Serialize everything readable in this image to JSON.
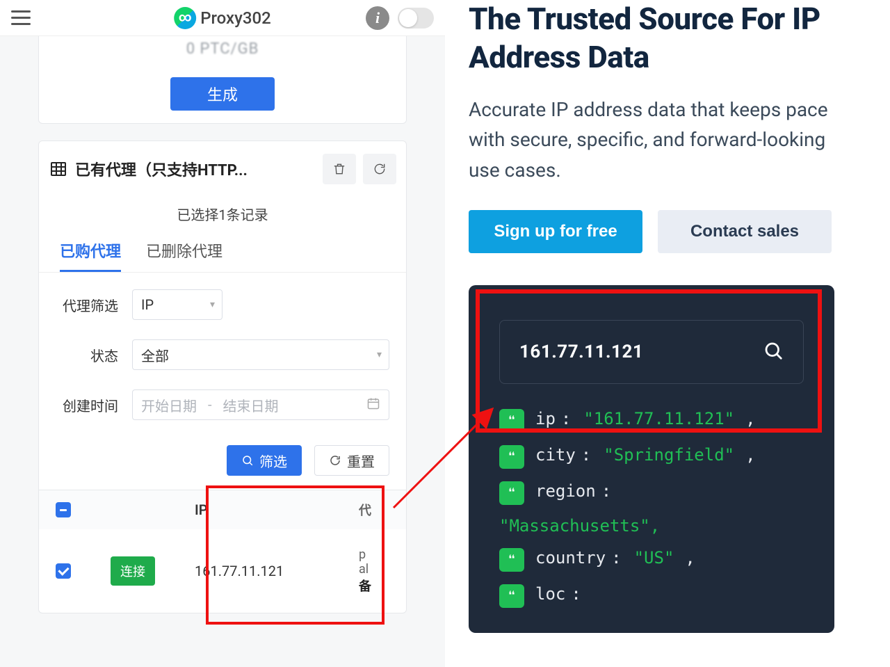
{
  "left": {
    "brand": "Proxy302",
    "price_text": "0 PTC/GB",
    "generate_btn": "生成",
    "card2_title": "已有代理（只支持HTTP...",
    "selected_note": "已选择1条记录",
    "tabs": {
      "purchased": "已购代理",
      "deleted": "已删除代理"
    },
    "filters": {
      "proxy_filter_label": "代理筛选",
      "proxy_filter_value": "IP",
      "status_label": "状态",
      "status_value": "全部",
      "created_label": "创建时间",
      "start_placeholder": "开始日期",
      "end_placeholder": "结束日期"
    },
    "actions": {
      "filter": "筛选",
      "reset": "重置"
    },
    "table": {
      "col_ip": "IP",
      "col_rest_head": "代",
      "row": {
        "connect": "连接",
        "ip": "161.77.11.121",
        "rest1": "p",
        "rest2": "al",
        "rest3": "备"
      }
    }
  },
  "right": {
    "title": "The Trusted Source For IP Address Data",
    "subtitle": "Accurate IP address data that keeps pace with secure, specific, and forward-looking use cases.",
    "cta_signup": "Sign up for free",
    "cta_contact": "Contact sales",
    "search_ip": "161.77.11.121",
    "kv": [
      {
        "key": "ip",
        "val": "\"161.77.11.121\"",
        "comma": true
      },
      {
        "key": "city",
        "val": "\"Springfield\"",
        "comma": true
      },
      {
        "key": "region",
        "val": "\"Massachusetts\"",
        "comma": true,
        "wrap": true
      },
      {
        "key": "country",
        "val": "\"US\"",
        "comma": true
      },
      {
        "key": "loc",
        "val": "",
        "comma": false,
        "colon_only": true
      }
    ]
  }
}
